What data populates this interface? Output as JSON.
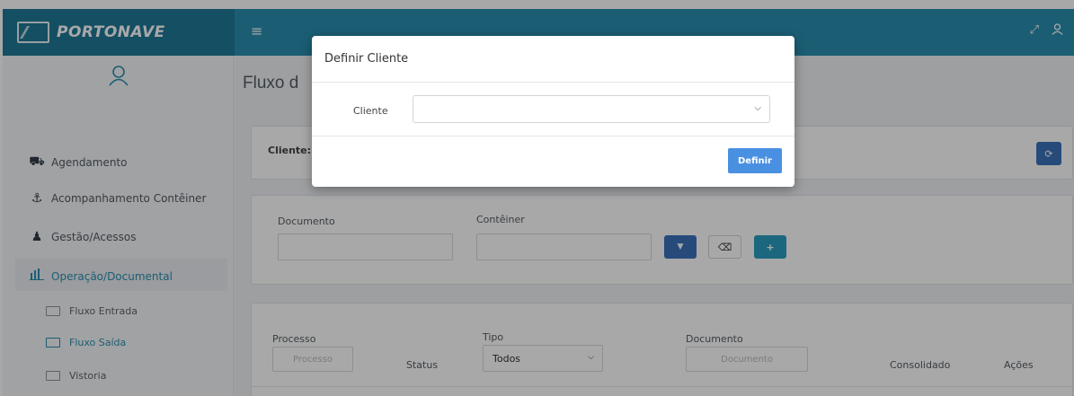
{
  "brand": {
    "name": "PORTONAVE"
  },
  "sidebar": {
    "items": [
      {
        "label": "Agendamento"
      },
      {
        "label": "Acompanhamento Contêiner"
      },
      {
        "label": "Gestão/Acessos"
      },
      {
        "label": "Operação/Documental"
      }
    ],
    "subitems": [
      {
        "label": "Fluxo Entrada"
      },
      {
        "label": "Fluxo Saída"
      },
      {
        "label": "Vistoria"
      }
    ]
  },
  "main": {
    "title": "Fluxo d",
    "client_label": "Cliente: 1",
    "filters": {
      "documento_label": "Documento",
      "conteiner_label": "Contêiner"
    },
    "table": {
      "processo_label": "Processo",
      "processo_placeholder": "Processo",
      "status_label": "Status",
      "tipo_label": "Tipo",
      "tipo_value": "Todos",
      "documento_label": "Documento",
      "documento_placeholder": "Documento",
      "consolidado_label": "Consolidado",
      "acoes_label": "Ações"
    }
  },
  "modal": {
    "title": "Definir Cliente",
    "cliente_label": "Cliente",
    "cliente_value": "",
    "submit_label": "Definir"
  },
  "colors": {
    "header": "#2a8fb0",
    "brand_bg": "#1f7896",
    "primary": "#4a90e2",
    "filter_btn": "#3b73b9",
    "add_btn": "#2a9ec0"
  }
}
